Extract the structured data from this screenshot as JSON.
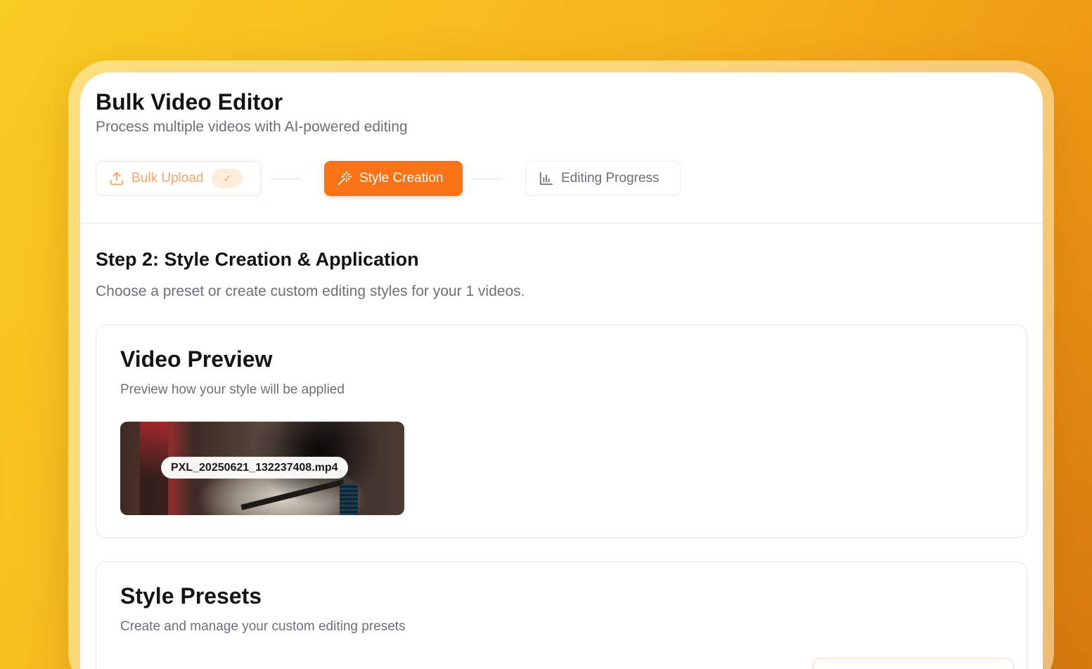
{
  "app": {
    "title": "Bulk Video Editor",
    "subtitle": "Process multiple videos with AI-powered editing"
  },
  "stepper": {
    "steps": [
      {
        "label": "Bulk Upload",
        "state": "done",
        "icon": "upload-icon",
        "badge": "✓"
      },
      {
        "label": "Style Creation",
        "state": "active",
        "icon": "magic-wand-icon"
      },
      {
        "label": "Editing Progress",
        "state": "pending",
        "icon": "bar-chart-icon"
      }
    ]
  },
  "step_header": {
    "title": "Step 2: Style Creation & Application",
    "description": "Choose a preset or create custom editing styles for your 1 videos."
  },
  "video_preview": {
    "title": "Video Preview",
    "description": "Preview how your style will be applied",
    "videos": [
      {
        "filename": "PXL_20250621_132237408.mp4"
      }
    ]
  },
  "style_presets": {
    "title": "Style Presets",
    "description": "Create and manage your custom editing presets"
  },
  "colors": {
    "accent": "#f97316",
    "accent_soft": "#f4a56a",
    "text_primary": "#141414",
    "text_muted": "#6f6f74"
  }
}
